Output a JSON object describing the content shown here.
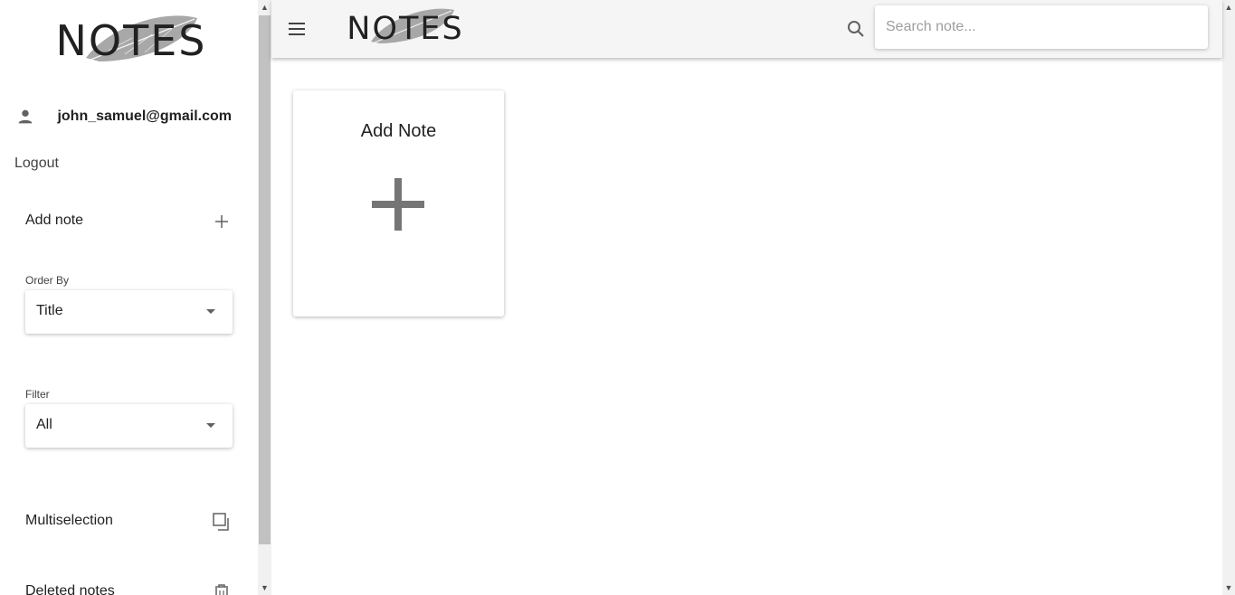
{
  "app": {
    "logo_text": "NOTES"
  },
  "sidebar": {
    "user_email": "john_samuel@gmail.com",
    "logout_label": "Logout",
    "add_note_label": "Add note",
    "order_by": {
      "label": "Order By",
      "selected": "Title"
    },
    "filter": {
      "label": "Filter",
      "selected": "All"
    },
    "multiselection_label": "Multiselection",
    "deleted_notes_label": "Deleted notes"
  },
  "header": {
    "search": {
      "placeholder": "Search note..."
    }
  },
  "main": {
    "add_card_title": "Add Note"
  },
  "icons": {
    "user": "person-icon",
    "add": "plus-icon",
    "dropdown": "caret-down-icon",
    "multiselection": "copy-squares-icon",
    "deleted": "trash-icon",
    "menu": "hamburger-icon",
    "search": "search-icon"
  },
  "colors": {
    "topbar_bg": "#f5f5f5",
    "feather": "#9e9e9e",
    "plus": "#757575",
    "text": "#212121"
  }
}
